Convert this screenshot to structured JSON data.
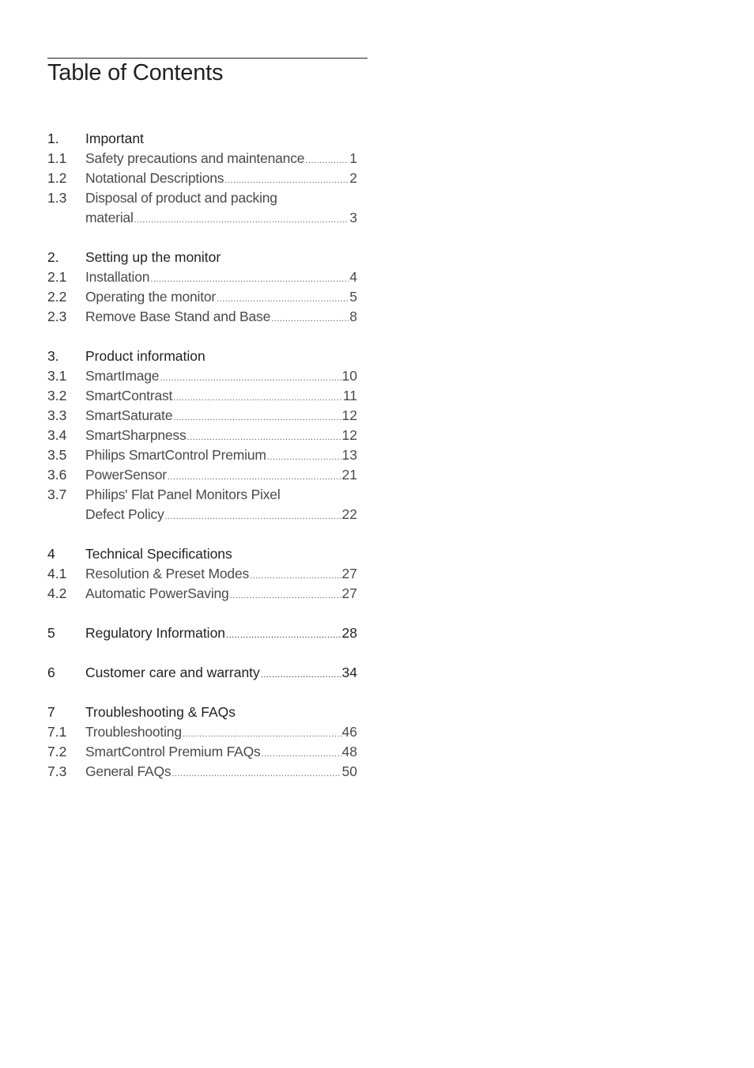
{
  "document": {
    "title": "Table of Contents"
  },
  "toc": {
    "s1": {
      "heading": {
        "num": "1.",
        "label": "Important"
      },
      "items": [
        {
          "num": "1.1",
          "label": "Safety precautions and maintenance",
          "page": "1"
        },
        {
          "num": "1.2",
          "label": "Notational Descriptions",
          "page": "2"
        },
        {
          "num": "1.3",
          "label": "Disposal of product and packing",
          "label_cont": "material",
          "page": "3"
        }
      ]
    },
    "s2": {
      "heading": {
        "num": "2.",
        "label": "Setting up the monitor"
      },
      "items": [
        {
          "num": "2.1",
          "label": "Installation",
          "page": "4"
        },
        {
          "num": "2.2",
          "label": "Operating the monitor",
          "page": "5"
        },
        {
          "num": "2.3",
          "label": "Remove Base Stand and Base",
          "page": "8"
        }
      ]
    },
    "s3": {
      "heading": {
        "num": "3.",
        "label": "Product information"
      },
      "items": [
        {
          "num": "3.1",
          "label": "SmartImage",
          "page": "10"
        },
        {
          "num": "3.2",
          "label": "SmartContrast",
          "page": "11"
        },
        {
          "num": "3.3",
          "label": "SmartSaturate",
          "page": "12"
        },
        {
          "num": "3.4",
          "label": "SmartSharpness",
          "page": "12"
        },
        {
          "num": "3.5",
          "label": "Philips SmartControl Premium",
          "page": "13"
        },
        {
          "num": "3.6",
          "label": "PowerSensor",
          "page": "21"
        },
        {
          "num": "3.7",
          "label": "Philips' Flat Panel Monitors Pixel",
          "label_cont": "Defect Policy",
          "page": "22"
        }
      ]
    },
    "s4": {
      "heading": {
        "num": "4",
        "label": "Technical Specifications"
      },
      "items": [
        {
          "num": "4.1",
          "label": "Resolution & Preset Modes",
          "page": "27"
        },
        {
          "num": "4.2",
          "label": "Automatic PowerSaving",
          "page": "27"
        }
      ]
    },
    "s5": {
      "num": "5",
      "label": "Regulatory Information",
      "page": "28"
    },
    "s6": {
      "num": "6",
      "label": "Customer care and warranty",
      "page": "34"
    },
    "s7": {
      "heading": {
        "num": "7",
        "label": "Troubleshooting & FAQs"
      },
      "items": [
        {
          "num": "7.1",
          "label": "Troubleshooting",
          "page": "46"
        },
        {
          "num": "7.2",
          "label": "SmartControl Premium FAQs",
          "page": "48"
        },
        {
          "num": "7.3",
          "label": "General FAQs",
          "page": "50"
        }
      ]
    }
  }
}
